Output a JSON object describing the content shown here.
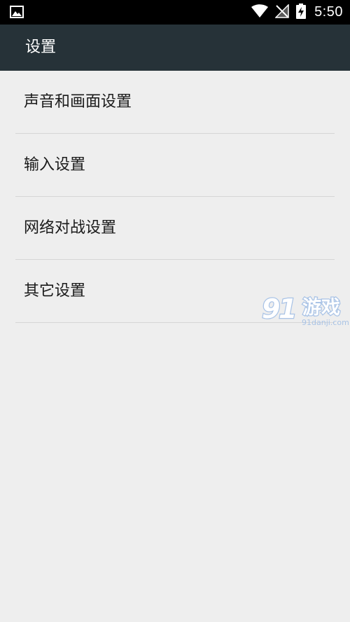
{
  "status_bar": {
    "time": "5:50",
    "icons": [
      "image-notification-icon",
      "wifi-icon",
      "no-signal-icon",
      "battery-charging-icon"
    ]
  },
  "toolbar": {
    "title": "设置"
  },
  "settings": {
    "items": [
      {
        "label": "声音和画面设置"
      },
      {
        "label": "输入设置"
      },
      {
        "label": "网络对战设置"
      },
      {
        "label": "其它设置"
      }
    ]
  },
  "watermark": {
    "brand": "91游戏",
    "url": "91danji.com"
  },
  "colors": {
    "status_bar_bg": "#000000",
    "toolbar_bg": "#263238",
    "page_bg": "#eeeeee",
    "divider": "#d6d6d6",
    "text_primary": "#1a1a1a",
    "watermark_blue": "#a9c3e6"
  }
}
